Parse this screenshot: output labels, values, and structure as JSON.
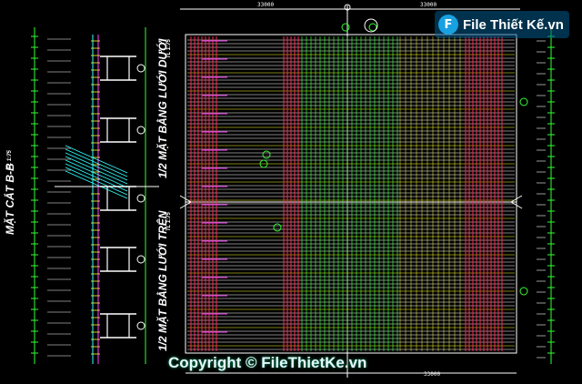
{
  "watermark": {
    "logo_text": "File Thiết Kế.vn",
    "copyright": "Copyright © FileThietKe.vn"
  },
  "labels": {
    "section": "MẶT CẮT B-B",
    "section_scale": "TL 1:75",
    "plan_bottom": "1/2 MẶT BẰNG LƯỚI DƯỚI",
    "plan_bottom_scale": "TL 1:75",
    "plan_top": "1/2 MẶT BẰNG LƯỚI TRÊN",
    "plan_top_scale": "TL 1:75"
  },
  "dimensions": {
    "top_left": "33000",
    "top_right": "33000",
    "bottom": "33000"
  },
  "colors": {
    "background": "#000000",
    "red": "#ff2a55",
    "yellow": "#ffff33",
    "green": "#33ff33",
    "white": "#ffffff",
    "cyan": "#33ffff",
    "magenta": "#ff44ff"
  }
}
